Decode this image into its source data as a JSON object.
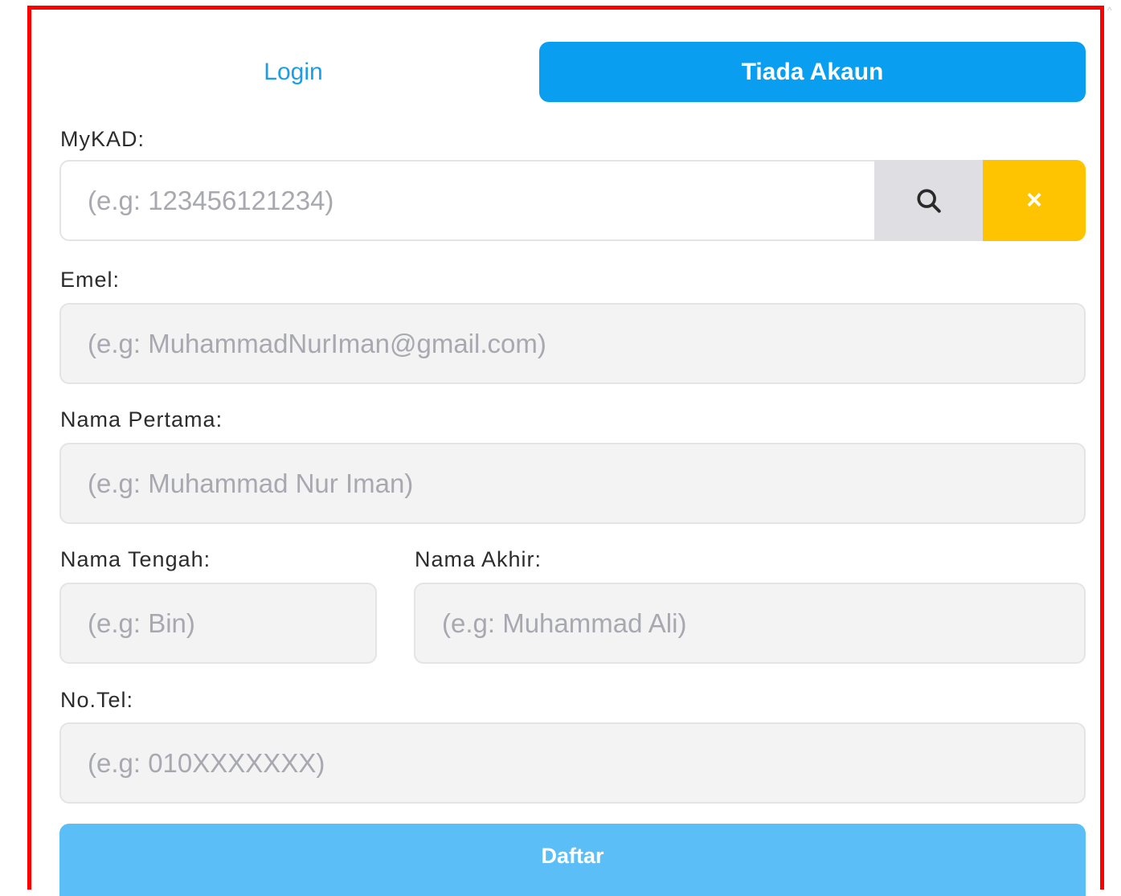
{
  "tabs": {
    "login_label": "Login",
    "register_label": "Tiada Akaun"
  },
  "form": {
    "mykad": {
      "label": "MyKAD:",
      "value": "",
      "placeholder": "(e.g: 123456121234)"
    },
    "search_icon": "search-icon",
    "clear_icon": "close-icon",
    "clear_symbol": "×",
    "email": {
      "label": "Emel:",
      "value": "",
      "placeholder": "(e.g: MuhammadNurIman@gmail.com)"
    },
    "first_name": {
      "label": "Nama Pertama:",
      "value": "",
      "placeholder": "(e.g: Muhammad Nur Iman)"
    },
    "middle_name": {
      "label": "Nama Tengah:",
      "value": "",
      "placeholder": "(e.g: Bin)"
    },
    "last_name": {
      "label": "Nama Akhir:",
      "value": "",
      "placeholder": "(e.g: Muhammad Ali)"
    },
    "phone": {
      "label": "No.Tel:",
      "value": "",
      "placeholder": "(e.g: 010XXXXXXX)"
    },
    "submit_label": "Daftar"
  },
  "colors": {
    "highlight_border": "#ff0000",
    "primary": "#0a9ef0",
    "submit": "#5bbef6",
    "clear_button": "#fec402",
    "search_button": "#dedee3"
  }
}
